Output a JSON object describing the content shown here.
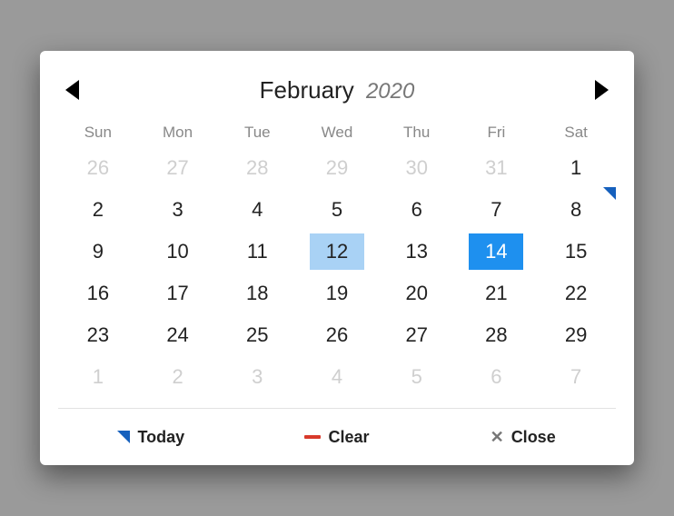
{
  "header": {
    "month": "February",
    "year": "2020"
  },
  "weekdays": [
    "Sun",
    "Mon",
    "Tue",
    "Wed",
    "Thu",
    "Fri",
    "Sat"
  ],
  "days": [
    {
      "n": 26,
      "out": true
    },
    {
      "n": 27,
      "out": true
    },
    {
      "n": 28,
      "out": true
    },
    {
      "n": 29,
      "out": true
    },
    {
      "n": 30,
      "out": true
    },
    {
      "n": 31,
      "out": true
    },
    {
      "n": 1
    },
    {
      "n": 2
    },
    {
      "n": 3
    },
    {
      "n": 4
    },
    {
      "n": 5
    },
    {
      "n": 6
    },
    {
      "n": 7
    },
    {
      "n": 8,
      "today": true
    },
    {
      "n": 9
    },
    {
      "n": 10
    },
    {
      "n": 11
    },
    {
      "n": 12,
      "highlight": true
    },
    {
      "n": 13
    },
    {
      "n": 14,
      "selected": true
    },
    {
      "n": 15
    },
    {
      "n": 16
    },
    {
      "n": 17
    },
    {
      "n": 18
    },
    {
      "n": 19
    },
    {
      "n": 20
    },
    {
      "n": 21
    },
    {
      "n": 22
    },
    {
      "n": 23
    },
    {
      "n": 24
    },
    {
      "n": 25
    },
    {
      "n": 26
    },
    {
      "n": 27
    },
    {
      "n": 28
    },
    {
      "n": 29
    },
    {
      "n": 1,
      "out": true
    },
    {
      "n": 2,
      "out": true
    },
    {
      "n": 3,
      "out": true
    },
    {
      "n": 4,
      "out": true
    },
    {
      "n": 5,
      "out": true
    },
    {
      "n": 6,
      "out": true
    },
    {
      "n": 7,
      "out": true
    }
  ],
  "footer": {
    "today": "Today",
    "clear": "Clear",
    "close": "Close"
  },
  "colors": {
    "selected": "#1e90ef",
    "highlight": "#a9d2f5",
    "marker": "#1560bd",
    "clear": "#d83a2b"
  }
}
